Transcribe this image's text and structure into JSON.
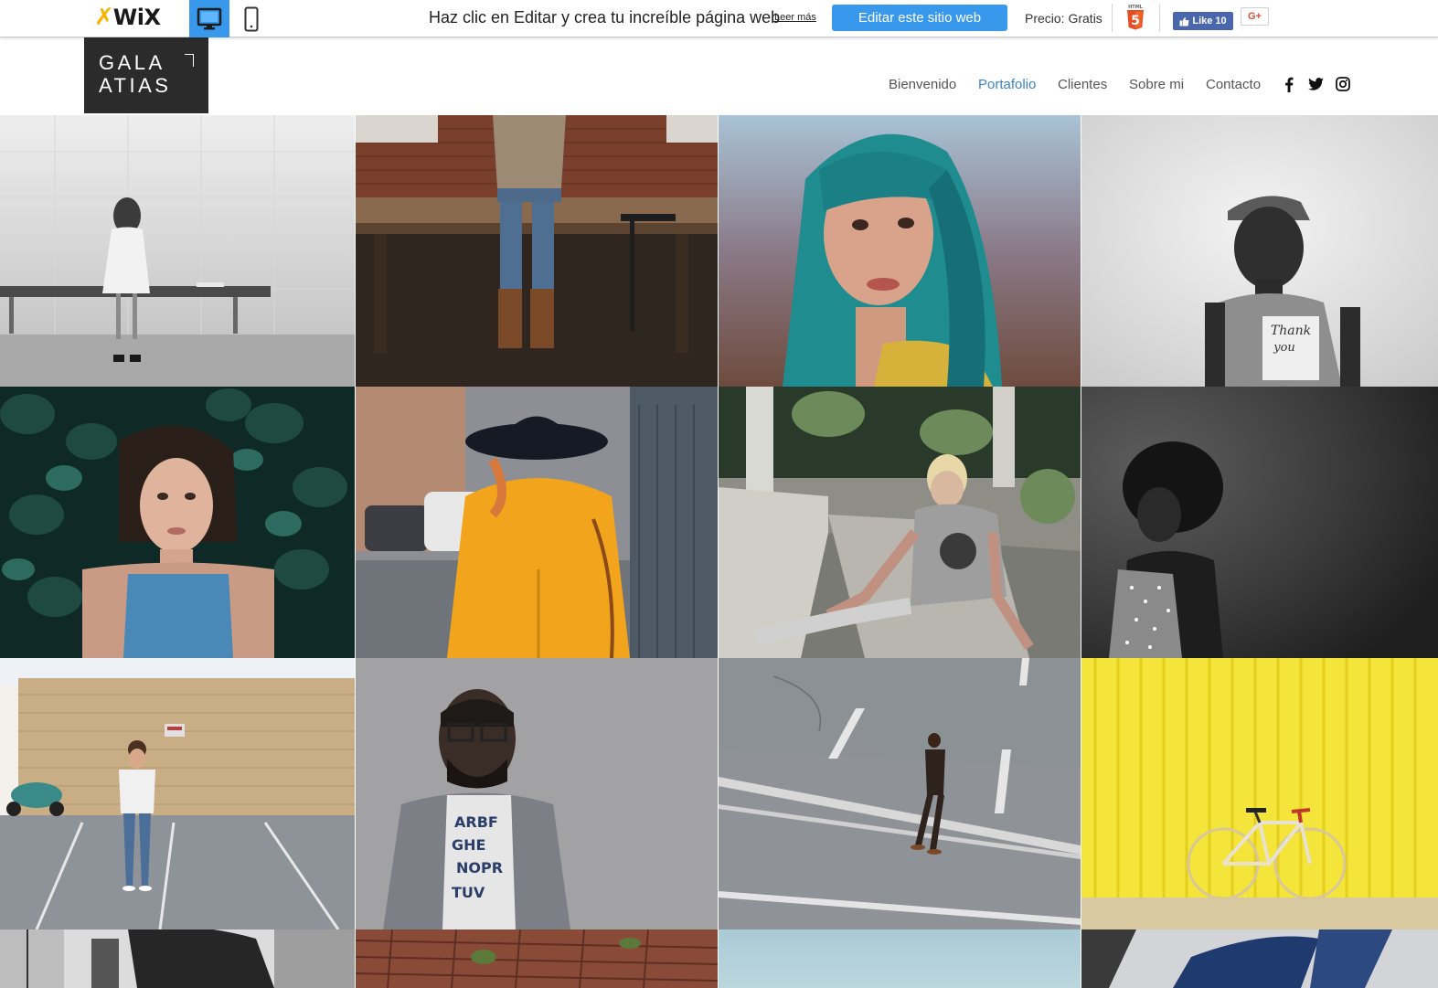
{
  "wix_bar": {
    "logo_text": "WiX",
    "banner_text": "Haz clic en Editar y crea tu increíble página web",
    "read_more": "Leer más",
    "edit_button": "Editar este sitio web",
    "price": "Precio: Gratis",
    "like_label": "Like 10",
    "gplus_label": "G+",
    "icons": [
      "wix-logo-icon",
      "desktop-icon",
      "mobile-icon",
      "html5-icon",
      "facebook-like-icon",
      "google-plus-icon"
    ]
  },
  "site": {
    "logo_line1": "GALA",
    "logo_line2": "ATIAS",
    "nav": [
      {
        "label": "Bienvenido",
        "active": false
      },
      {
        "label": "Portafolio",
        "active": true
      },
      {
        "label": "Clientes",
        "active": false
      },
      {
        "label": "Sobre mi",
        "active": false
      },
      {
        "label": "Contacto",
        "active": false
      }
    ],
    "social_icons": [
      "facebook-icon",
      "twitter-icon",
      "instagram-icon"
    ]
  },
  "colors": {
    "accent": "#3899ec",
    "nav_active": "#3b83c3",
    "logo_bg": "#2b2b2b"
  },
  "gallery": {
    "photos": [
      "woman-on-bench-bw",
      "person-sitting-on-table",
      "teal-hair-woman",
      "boy-cap-thank-you-shirt-bw",
      "woman-in-ivy-leaves",
      "yellow-coat-black-hat",
      "blonde-tattooed-woman-sitting",
      "curly-hair-woman-bw",
      "woman-parking-lot",
      "man-with-glasses-jacket",
      "man-walking-on-road",
      "bicycle-yellow-wall",
      "bw-street-partial",
      "brick-pavement-partial",
      "sky-partial",
      "jeans-partial"
    ]
  }
}
